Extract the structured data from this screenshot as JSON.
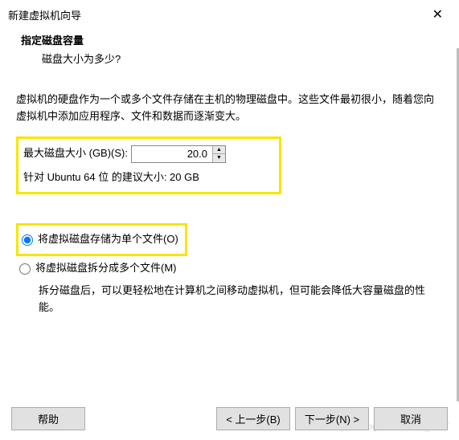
{
  "window": {
    "title": "新建虚拟机向导",
    "close": "✕"
  },
  "header": {
    "title": "指定磁盘容量",
    "subtitle": "磁盘大小为多少?"
  },
  "description": "虚拟机的硬盘作为一个或多个文件存储在主机的物理磁盘中。这些文件最初很小，随着您向虚拟机中添加应用程序、文件和数据而逐渐变大。",
  "disk": {
    "size_label": "最大磁盘大小 (GB)(S):",
    "size_value": "20.0",
    "recommend": "针对 Ubuntu 64 位 的建议大小: 20 GB"
  },
  "radios": {
    "single": "将虚拟磁盘存储为单个文件(O)",
    "split": "将虚拟磁盘拆分成多个文件(M)",
    "split_desc": "拆分磁盘后，可以更轻松地在计算机之间移动虚拟机，但可能会降低大容量磁盘的性能。"
  },
  "buttons": {
    "help": "帮助",
    "back": "< 上一步(B)",
    "next": "下一步(N) >",
    "cancel": "取消"
  },
  "watermark": "https://blog.csdn.net/a_YSY"
}
